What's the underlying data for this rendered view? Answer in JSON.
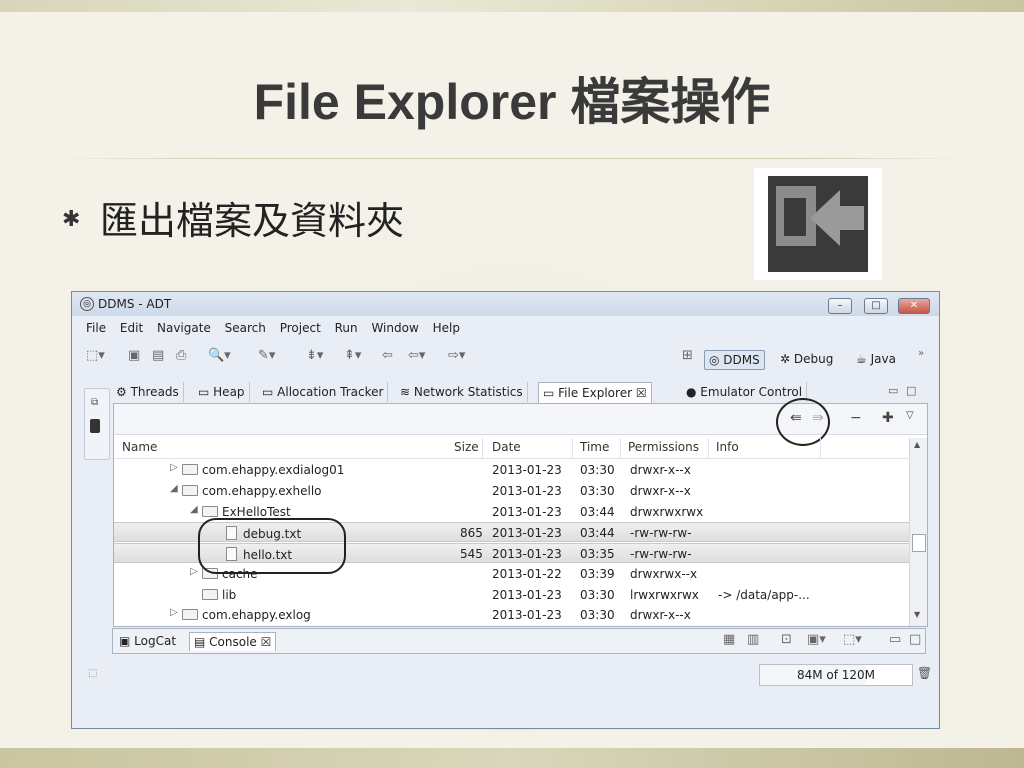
{
  "slide": {
    "title": "File Explorer 檔案操作",
    "bullet_mark": "✱",
    "bullet": "匯出檔案及資料夾"
  },
  "window": {
    "title": "DDMS - ADT",
    "menu": [
      "File",
      "Edit",
      "Navigate",
      "Search",
      "Project",
      "Run",
      "Window",
      "Help"
    ],
    "perspectives": {
      "ddms": "DDMS",
      "debug": "Debug",
      "java": "Java"
    },
    "view_tabs": {
      "threads": "Threads",
      "heap": "Heap",
      "allocation": "Allocation Tracker",
      "network": "Network Statistics",
      "file_explorer": "File Explorer",
      "emulator": "Emulator Control"
    },
    "columns": {
      "name": "Name",
      "size": "Size",
      "date": "Date",
      "time": "Time",
      "permissions": "Permissions",
      "info": "Info"
    },
    "rows": [
      {
        "name": "com.ehappy.exdialog01",
        "size": "",
        "date": "2013-01-23",
        "time": "03:30",
        "perm": "drwxr-x--x",
        "info": ""
      },
      {
        "name": "com.ehappy.exhello",
        "size": "",
        "date": "2013-01-23",
        "time": "03:30",
        "perm": "drwxr-x--x",
        "info": ""
      },
      {
        "name": "ExHelloTest",
        "size": "",
        "date": "2013-01-23",
        "time": "03:44",
        "perm": "drwxrwxrwx",
        "info": ""
      },
      {
        "name": "debug.txt",
        "size": "865",
        "date": "2013-01-23",
        "time": "03:44",
        "perm": "-rw-rw-rw-",
        "info": ""
      },
      {
        "name": "hello.txt",
        "size": "545",
        "date": "2013-01-23",
        "time": "03:35",
        "perm": "-rw-rw-rw-",
        "info": ""
      },
      {
        "name": "cache",
        "size": "",
        "date": "2013-01-22",
        "time": "03:39",
        "perm": "drwxrwx--x",
        "info": ""
      },
      {
        "name": "lib",
        "size": "",
        "date": "2013-01-23",
        "time": "03:30",
        "perm": "lrwxrwxrwx",
        "info": "-> /data/app-..."
      },
      {
        "name": "com.ehappy.exlog",
        "size": "",
        "date": "2013-01-23",
        "time": "03:30",
        "perm": "drwxr-x--x",
        "info": ""
      }
    ],
    "bottom_tabs": {
      "logcat": "LogCat",
      "console": "Console"
    },
    "memory": "84M of 120M",
    "memory_used_fraction": 0.7
  }
}
